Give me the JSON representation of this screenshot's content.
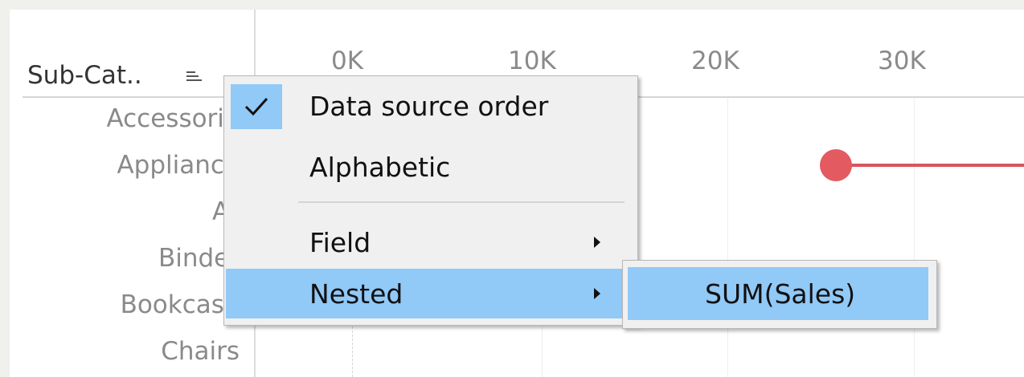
{
  "header": {
    "title": "Sub-Cat..",
    "sort_icon": "sort-descending-icon"
  },
  "axis": {
    "ticks": [
      "0K",
      "10K",
      "20K",
      "30K"
    ]
  },
  "rows": [
    {
      "label": "Accessorie"
    },
    {
      "label": "Appliance"
    },
    {
      "label": "Ar"
    },
    {
      "label": "Binder"
    },
    {
      "label": "Bookcase"
    },
    {
      "label": "Chairs"
    }
  ],
  "colors": {
    "mark": "#e35a60",
    "menu_highlight": "#91c9f7",
    "menu_bg": "#f0f0f0"
  },
  "context_menu": {
    "items": [
      {
        "label": "Data source order",
        "checked": true
      },
      {
        "label": "Alphabetic"
      },
      {
        "label": "Field",
        "submenu": true
      },
      {
        "label": "Nested",
        "submenu": true,
        "highlighted": true
      }
    ]
  },
  "submenu": {
    "items": [
      {
        "label": "SUM(Sales)",
        "highlighted": true
      }
    ]
  }
}
